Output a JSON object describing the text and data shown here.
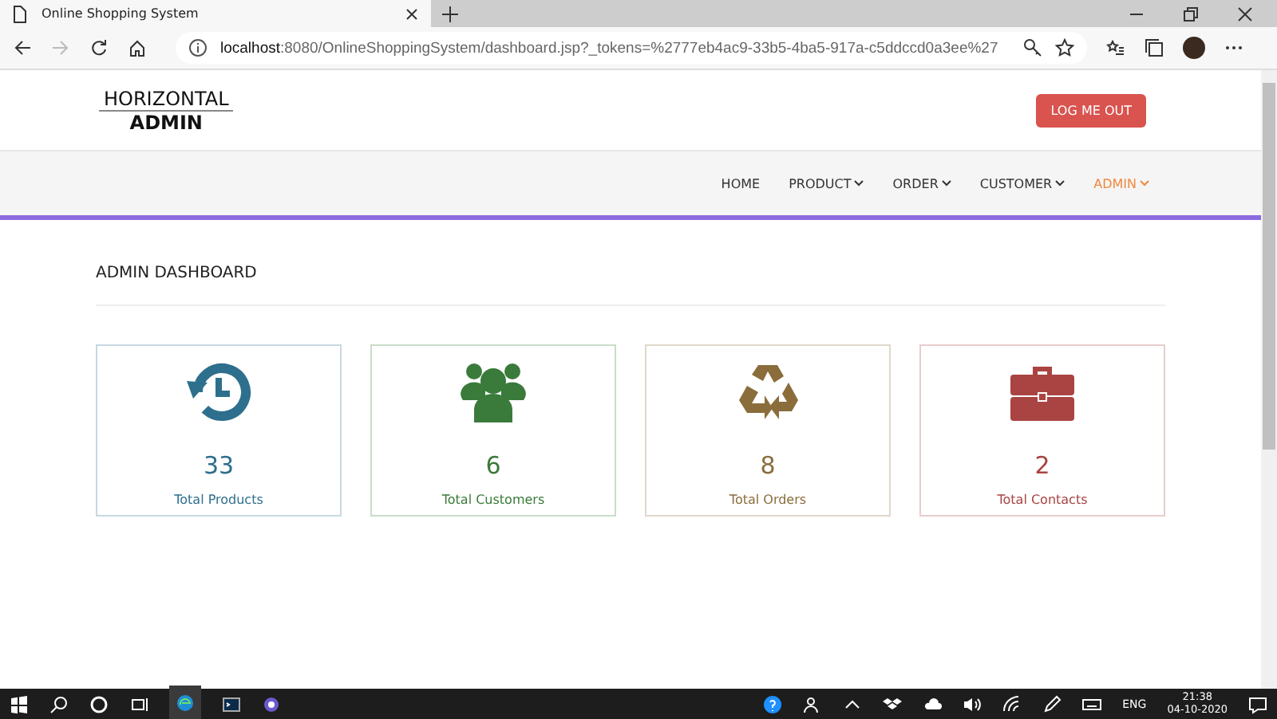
{
  "browser": {
    "tab_title": "Online Shopping System",
    "url_host": "localhost",
    "url_rest": ":8080/OnlineShoppingSystem/dashboard.jsp?_tokens=%2777eb4ac9-33b5-4ba5-917a-c5ddccd0a3ee%27"
  },
  "header": {
    "logo_top": "HORIZONTAL",
    "logo_bottom": "ADMIN",
    "logout": "LOG ME OUT"
  },
  "nav": [
    {
      "label": "HOME",
      "dropdown": false,
      "selected": false
    },
    {
      "label": "PRODUCT",
      "dropdown": true,
      "selected": false
    },
    {
      "label": "ORDER",
      "dropdown": true,
      "selected": false
    },
    {
      "label": "CUSTOMER",
      "dropdown": true,
      "selected": false
    },
    {
      "label": "ADMIN",
      "dropdown": true,
      "selected": true
    }
  ],
  "heading": "ADMIN DASHBOARD",
  "cards": [
    {
      "kind": "history",
      "value": "33",
      "label": "Total Products",
      "color": "#2e6f8e"
    },
    {
      "kind": "users",
      "value": "6",
      "label": "Total Customers",
      "color": "#3a7a3a"
    },
    {
      "kind": "recycle",
      "value": "8",
      "label": "Total Orders",
      "color": "#8a6d3b"
    },
    {
      "kind": "briefcase",
      "value": "2",
      "label": "Total Contacts",
      "color": "#a94442"
    }
  ],
  "taskbar": {
    "language": "ENG",
    "time": "21:38",
    "date": "04-10-2020"
  }
}
